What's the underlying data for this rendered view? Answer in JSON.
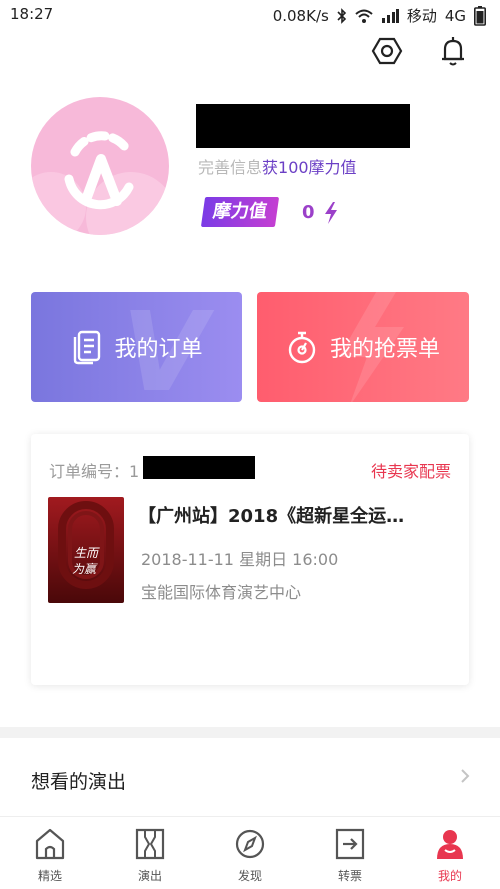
{
  "status_bar": {
    "time": "18:27",
    "network_speed": "0.08K/s",
    "carrier": "移动",
    "network_type": "4G",
    "icons": [
      "bluetooth-icon",
      "wifi-icon",
      "signal-icon",
      "battery-icon"
    ]
  },
  "header": {
    "settings_icon": "hexagon-settings-icon",
    "notification_icon": "bell-icon"
  },
  "profile": {
    "complete_prefix": "完善信息",
    "complete_reward": "获100摩力值",
    "points_label": "摩力值",
    "points_value": "0"
  },
  "actions": {
    "orders_label": "我的订单",
    "tickets_label": "我的抢票单"
  },
  "order": {
    "number_label": "订单编号：1",
    "status": "待卖家配票",
    "title": "【广州站】2018《超新星全运…",
    "datetime": "2018-11-11  星期日 16:00",
    "venue": "宝能国际体育演艺中心"
  },
  "wishlist": {
    "label": "想看的演出"
  },
  "tabs": [
    {
      "label": "精选",
      "icon": "home-icon"
    },
    {
      "label": "演出",
      "icon": "ticket-icon"
    },
    {
      "label": "发现",
      "icon": "compass-icon"
    },
    {
      "label": "转票",
      "icon": "transfer-icon"
    },
    {
      "label": "我的",
      "icon": "profile-icon"
    }
  ],
  "colors": {
    "accent_red": "#e8364f",
    "purple": "#6b3fc5",
    "orders_gradient": "#7a76de",
    "tickets_gradient": "#ff5d6e"
  }
}
